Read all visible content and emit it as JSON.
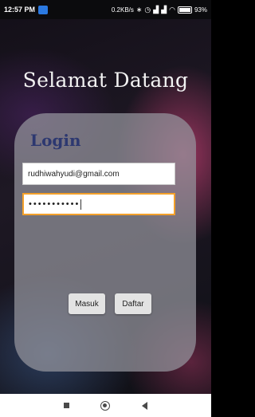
{
  "status_bar": {
    "time": "12:57 PM",
    "speed": "0.2KB/s",
    "battery_percent": "93%",
    "icons": [
      "app-notification-icon",
      "bluetooth-icon",
      "alarm-icon",
      "signal-icon",
      "signal-icon",
      "wifi-icon",
      "battery-icon"
    ]
  },
  "welcome_title": "Selamat Datang",
  "login": {
    "title": "Login",
    "email_value": "rudhiwahyudi@gmail.com",
    "password_mask": "•••••••••••",
    "masuk_label": "Masuk",
    "daftar_label": "Daftar"
  },
  "colors": {
    "title_text": "#2d3870",
    "focus_border": "#f3a02a"
  },
  "nav_bar": {
    "icons": [
      "recents-icon",
      "home-icon",
      "back-icon"
    ]
  }
}
